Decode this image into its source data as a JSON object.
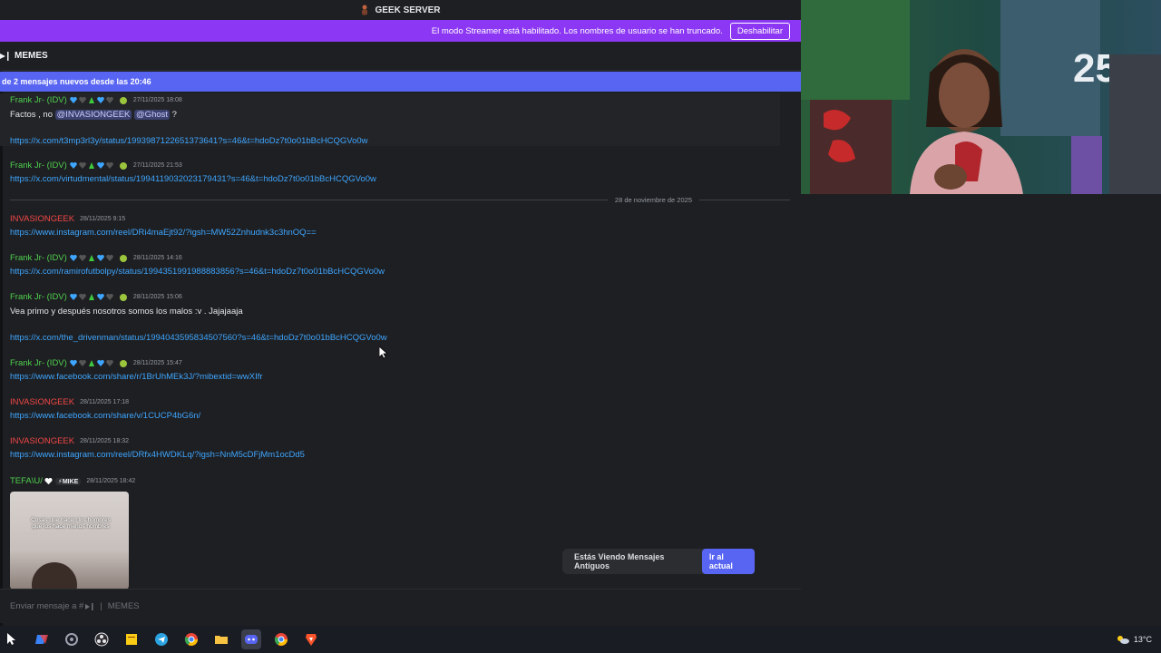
{
  "titlebar": {
    "server_name": "GEEK SERVER"
  },
  "notice": {
    "text": "El modo Streamer está habilitado. Los nombres de usuario se han truncado.",
    "button": "Deshabilitar"
  },
  "channel": {
    "name": "MEMES"
  },
  "new_messages_bar": {
    "text": "de 2 mensajes nuevos desde las 20:46"
  },
  "messages": [
    {
      "author": "Frank Jr- (IDV)",
      "timestamp": "27/11/2025 18:08",
      "text_prefix": "Factos , no ",
      "mention1": "@INVASIONGEEK",
      "mention2": "@Ghost",
      "text_suffix": " ?",
      "link": "https://x.com/t3mp3rl3y/status/1993987122651373641?s=46&t=hdoDz7t0o01bBcHCQGVo0w"
    },
    {
      "author": "Frank Jr- (IDV)",
      "timestamp": "27/11/2025 21:53",
      "link": "https://x.com/virtudmental/status/1994119032023179431?s=46&t=hdoDz7t0o01bBcHCQGVo0w"
    },
    {
      "author": "INVASIONGEEK",
      "timestamp": "28/11/2025 9:15",
      "link": "https://www.instagram.com/reel/DRi4maEjt92/?igsh=MW52Znhudnk3c3hnOQ=="
    },
    {
      "author": "Frank Jr- (IDV)",
      "timestamp": "28/11/2025 14:16",
      "link": "https://x.com/ramirofutbolpy/status/1994351991988883856?s=46&t=hdoDz7t0o01bBcHCQGVo0w"
    },
    {
      "author": "Frank Jr- (IDV)",
      "timestamp": "28/11/2025 15:06",
      "text": "Vea  primo  y después nosotros somos los malos :v . Jajajaaja",
      "link": "https://x.com/the_drivenman/status/1994043595834507560?s=46&t=hdoDz7t0o01bBcHCQGVo0w"
    },
    {
      "author": "Frank Jr- (IDV)",
      "timestamp": "28/11/2025 15:47",
      "link": "https://www.facebook.com/share/r/1BrUhMEk3J/?mibextid=wwXIfr"
    },
    {
      "author": "INVASIONGEEK",
      "timestamp": "28/11/2025 17:18",
      "link": "https://www.facebook.com/share/v/1CUCP4bG6n/"
    },
    {
      "author": "INVASIONGEEK",
      "timestamp": "28/11/2025 18:32",
      "link": "https://www.instagram.com/reel/DRfx4HWDKLq/?igsh=NnM5cDFjMm1ocDd5"
    },
    {
      "author": "TEFA\\U/",
      "tag": "MIKE",
      "timestamp": "28/11/2025 18:42",
      "image_caption": "Cosas que hacen los hombres que los hace menos hombres"
    }
  ],
  "date_divider": "28 de noviembre de 2025",
  "jump_bar": {
    "text": "Estás Viendo Mensajes Antiguos",
    "button": "Ir al actual"
  },
  "composer": {
    "placeholder": "Enviar mensaje a #",
    "channel": "MEMES"
  },
  "tray": {
    "weather": "13°C"
  },
  "colors": {
    "accent": "#5865f2",
    "streamer": "#8c37f3",
    "green_name": "#4fd14f",
    "red_name": "#f04747",
    "link": "#3ea6ff"
  }
}
